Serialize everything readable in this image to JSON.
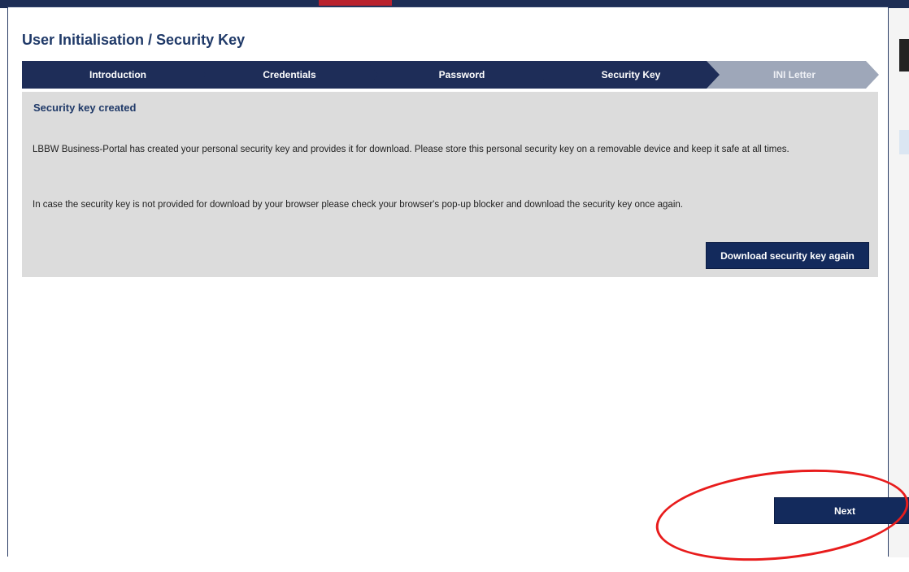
{
  "dialog": {
    "title": "User Initialisation / Security Key"
  },
  "steps": [
    {
      "label": "Introduction",
      "state": "completed"
    },
    {
      "label": "Credentials",
      "state": "completed"
    },
    {
      "label": "Password",
      "state": "completed"
    },
    {
      "label": "Security Key",
      "state": "current"
    },
    {
      "label": "INI Letter",
      "state": "inactive"
    }
  ],
  "panel": {
    "heading": "Security key created",
    "paragraph1": "LBBW Business-Portal has created your personal security key and provides it for download. Please store this personal security key on a removable device and keep it safe at all times.",
    "paragraph2": "In case the security key is not provided for download by your browser please check your browser's pop-up blocker and download the security key once again.",
    "download_button": "Download security key again"
  },
  "footer": {
    "next_button": "Next"
  },
  "colors": {
    "step_active": "#1e2d58",
    "step_inactive": "#9ea7b9",
    "button": "#132a5c",
    "title": "#1f3968",
    "panel_bg": "#dcdcdc",
    "annotation": "#e81c1c"
  }
}
